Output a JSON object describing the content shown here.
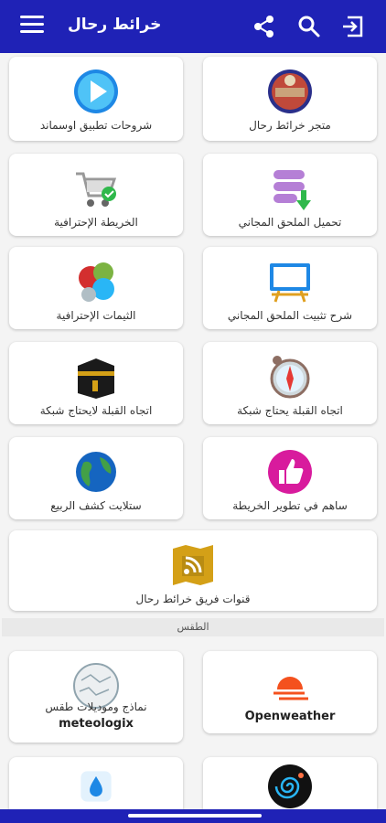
{
  "appbar": {
    "title": "خرائط رحال",
    "icons": [
      "menu-icon",
      "share-icon",
      "search-icon",
      "exit-icon"
    ],
    "color": "#1f22b6"
  },
  "cards": [
    {
      "label": "متجر خرائط رحال",
      "icon": "store-icon"
    },
    {
      "label": "شروحات تطبيق اوسماند",
      "icon": "play-icon"
    },
    {
      "label": "تحميل الملحق المجاني",
      "icon": "database-download-icon"
    },
    {
      "label": "الخريطة الإحترافية",
      "icon": "cart-icon"
    },
    {
      "label": "شرح تثبيت الملحق المجاني",
      "icon": "whiteboard-icon"
    },
    {
      "label": "الثيمات الإحترافية",
      "icon": "circles-icon"
    },
    {
      "label": "اتجاه القبلة يحتاج شبكة",
      "icon": "compass-icon"
    },
    {
      "label": "اتجاه القبلة لايحتاج شبكة",
      "icon": "kaaba-icon"
    },
    {
      "label": "ساهم في تطوير الخريطة",
      "icon": "thumbs-up-icon"
    },
    {
      "label": "ستلايت كشف الربيع",
      "icon": "globe-icon"
    },
    {
      "label": "قنوات فريق خرائط رحال",
      "icon": "map-rss-icon"
    }
  ],
  "weather_section": {
    "title": "الطقس",
    "cards": [
      {
        "label": "Openweather",
        "icon": "sun-cloud-icon"
      },
      {
        "label": "نماذج وموديلات طقس",
        "label2": "meteologix",
        "icon": "map-circle-icon"
      },
      {
        "label": "",
        "icon": "spiral-icon"
      },
      {
        "label": "",
        "icon": "drop-icon"
      }
    ]
  }
}
